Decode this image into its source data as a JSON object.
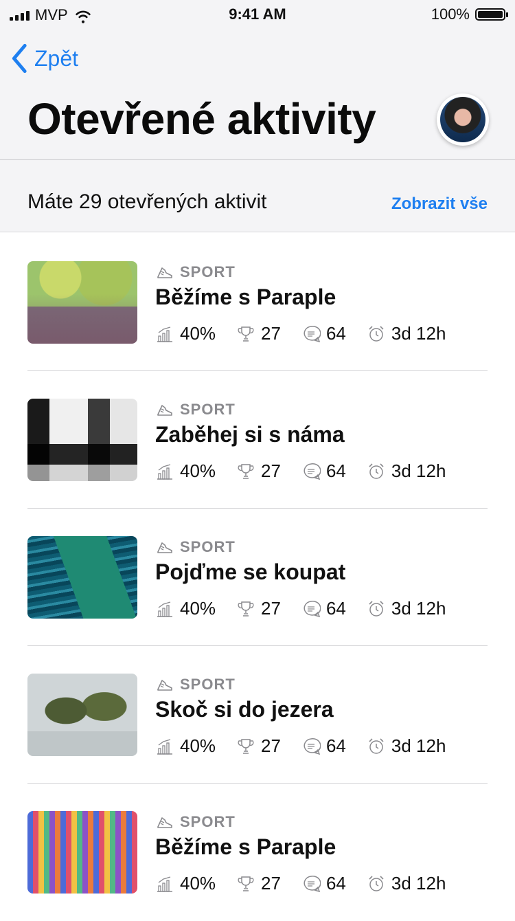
{
  "status_bar": {
    "carrier": "MVP",
    "time": "9:41 AM",
    "battery": "100%"
  },
  "nav": {
    "back_label": "Zpět",
    "title": "Otevřené aktivity",
    "avatar_icon": "user-avatar"
  },
  "summary": {
    "count_text": "Máte 29 otevřených aktivit",
    "show_all_label": "Zobrazit vše"
  },
  "activities": [
    {
      "category": "SPORT",
      "title": "Běžíme s Paraple",
      "progress": "40%",
      "trophies": "27",
      "comments": "64",
      "time_left": "3d 12h"
    },
    {
      "category": "SPORT",
      "title": "Zaběhej si s náma",
      "progress": "40%",
      "trophies": "27",
      "comments": "64",
      "time_left": "3d 12h"
    },
    {
      "category": "SPORT",
      "title": "Pojďme se koupat",
      "progress": "40%",
      "trophies": "27",
      "comments": "64",
      "time_left": "3d 12h"
    },
    {
      "category": "SPORT",
      "title": "Skoč si do jezera",
      "progress": "40%",
      "trophies": "27",
      "comments": "64",
      "time_left": "3d 12h"
    },
    {
      "category": "SPORT",
      "title": "Běžíme s Paraple",
      "progress": "40%",
      "trophies": "27",
      "comments": "64",
      "time_left": "3d 12h"
    }
  ],
  "colors": {
    "accent": "#1e7ff0",
    "header_bg": "#f4f4f6",
    "muted": "#8a8a8e"
  }
}
